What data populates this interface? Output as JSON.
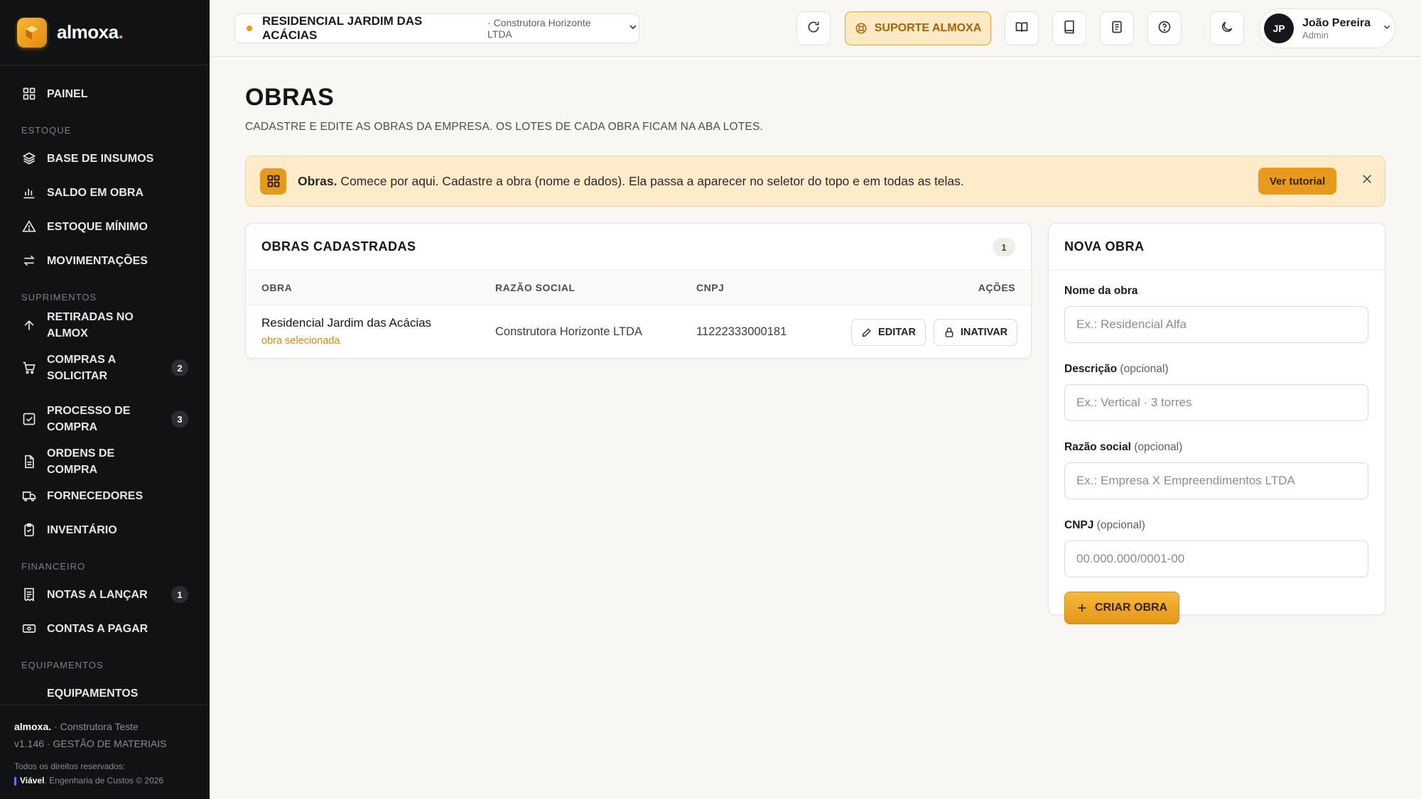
{
  "brand": {
    "name": "almoxa",
    "dot": "."
  },
  "sidebar": {
    "items": [
      {
        "key": "painel",
        "label": "PAINEL",
        "icon": "grid-icon"
      },
      {
        "section": "ESTOQUE"
      },
      {
        "key": "base",
        "label": "BASE DE INSUMOS",
        "icon": "layers-icon"
      },
      {
        "key": "saldo",
        "label": "SALDO EM OBRA",
        "icon": "bar-chart-icon"
      },
      {
        "key": "estoque-minimo",
        "label": "ESTOQUE MÍNIMO",
        "icon": "warning-icon"
      },
      {
        "key": "movimentacoes",
        "label": "MOVIMENTAÇÕES",
        "icon": "arrows-swap-icon"
      },
      {
        "section": "SUPRIMENTOS"
      },
      {
        "key": "retiradas",
        "label": "RETIRADAS NO ALMOX",
        "icon": "arrow-up-icon"
      },
      {
        "key": "compras",
        "label": "COMPRAS A SOLICITAR",
        "icon": "cart-icon",
        "badge": "2"
      },
      {
        "key": "processo",
        "label": "PROCESSO DE COMPRA",
        "icon": "checkbox-icon",
        "badge": "3"
      },
      {
        "key": "ordens",
        "label": "ORDENS DE COMPRA",
        "icon": "document-icon"
      },
      {
        "key": "fornecedores",
        "label": "FORNECEDORES",
        "icon": "truck-icon"
      },
      {
        "key": "inventario",
        "label": "INVENTÁRIO",
        "icon": "clipboard-icon"
      },
      {
        "section": "FINANCEIRO"
      },
      {
        "key": "notas",
        "label": "NOTAS A LANÇAR",
        "icon": "receipt-icon",
        "badge": "1"
      },
      {
        "key": "contas",
        "label": "CONTAS A PAGAR",
        "icon": "cash-icon"
      },
      {
        "section": "EQUIPAMENTOS"
      },
      {
        "key": "equipamentos",
        "label": "EQUIPAMENTOS",
        "icon": "tool-icon"
      }
    ],
    "footer": {
      "brand": "almoxa.",
      "company": " · Construtora Teste",
      "version": "v1.146 · GESTÃO DE MATERIAIS",
      "rights": "Todos os direitos reservados:",
      "vendor": "Viável",
      "vendor_rest": ". Engenharia de Custos © 2026"
    }
  },
  "topbar": {
    "obra_name": "RESIDENCIAL JARDIM DAS ACÁCIAS",
    "obra_company": "· Construtora Horizonte LTDA",
    "support_label": "SUPORTE ALMOXA",
    "user_initials": "JP",
    "user_name": "João Pereira",
    "user_role": "Admin"
  },
  "page": {
    "title": "OBRAS",
    "subtitle": "CADASTRE E EDITE AS OBRAS DA EMPRESA. OS LOTES DE CADA OBRA FICAM NA ABA LOTES."
  },
  "banner": {
    "bold": "Obras.",
    "text": " Comece por aqui. Cadastre a obra (nome e dados). Ela passa a aparecer no seletor do topo e em todas as telas.",
    "button": "Ver tutorial"
  },
  "list": {
    "title": "OBRAS CADASTRADAS",
    "count": "1",
    "headers": {
      "obra": "OBRA",
      "razao": "RAZÃO SOCIAL",
      "cnpj": "CNPJ",
      "acoes": "AÇÕES"
    },
    "rows": [
      {
        "name": "Residencial Jardim das Acácias",
        "tag": "obra selecionada",
        "razao": "Construtora Horizonte LTDA",
        "cnpj": "11222333000181",
        "edit": "EDITAR",
        "inactivate": "INATIVAR"
      }
    ]
  },
  "form": {
    "title": "NOVA OBRA",
    "nome_label": "Nome da obra",
    "nome_placeholder": "Ex.: Residencial Alfa",
    "desc_label": "Descrição",
    "desc_opt": "(opcional)",
    "desc_placeholder": "Ex.: Vertical · 3 torres",
    "razao_label": "Razão social",
    "razao_opt": "(opcional)",
    "razao_placeholder": "Ex.: Empresa X Empreendimentos LTDA",
    "cnpj_label": "CNPJ",
    "cnpj_opt": "(opcional)",
    "cnpj_placeholder": "00.000.000/0001-00",
    "submit": "CRIAR OBRA"
  },
  "colors": {
    "accent": "#e89a1c",
    "sidebar_bg": "#111214",
    "banner_bg": "#fdebc9"
  }
}
